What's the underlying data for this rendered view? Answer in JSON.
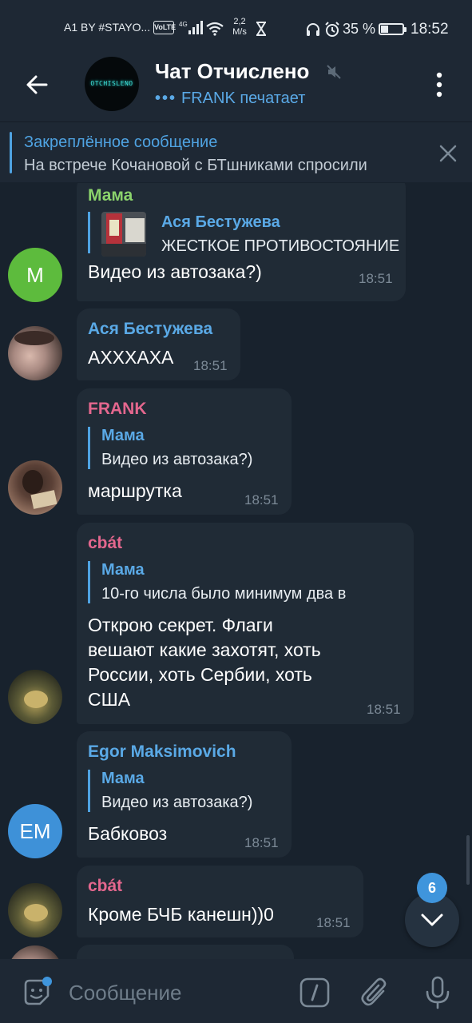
{
  "status_bar": {
    "carrier": "A1 BY #STAYO...",
    "volte": "VoLTE",
    "network": "4G",
    "speed_value": "2,2",
    "speed_unit": "M/s",
    "battery_text": "35 %",
    "battery_level": 0.35,
    "time": "18:52"
  },
  "header": {
    "title": "Чат Отчислено",
    "avatar_logo": "OTCHISLENO",
    "typing_dots": "•••",
    "typing_text": "FRANK печатает"
  },
  "pinned": {
    "title": "Закреплённое сообщение",
    "text": "На встрече Кочановой с БТшниками спросили"
  },
  "colors": {
    "accent": "#4fa3e2",
    "sender_mama": "#8bd36c",
    "sender_asya": "#5aa9e6",
    "sender_frank": "#e4678e",
    "sender_cbat": "#e4678e",
    "sender_egor": "#5aa9e6",
    "avatar_m": "#5dbb3d",
    "avatar_em": "#3e91d8"
  },
  "messages": [
    {
      "sender": "Мама",
      "reply_name": "Ася Бестужева",
      "reply_text": "ЖЕСТКОЕ ПРОТИВОСТОЯНИЕ",
      "text": "Видео из автозака?)",
      "time": "18:51",
      "avatar_letter": "М"
    },
    {
      "sender": "Ася Бестужева",
      "text": "АХХХАХА",
      "time": "18:51"
    },
    {
      "sender": "FRANK",
      "reply_name": "Мама",
      "reply_text": "Видео из автозака?)",
      "text": "маршрутка",
      "time": "18:51"
    },
    {
      "sender": "cbát",
      "reply_name": "Мама",
      "reply_text": "10-го числа было минимум два в",
      "text_lines": [
        "Открою секрет. Флаги",
        "вешают какие захотят, хоть",
        "России, хоть Сербии, хоть",
        "США"
      ],
      "time": "18:51"
    },
    {
      "sender": "Egor Maksimovich",
      "reply_name": "Мама",
      "reply_text": "Видео из автозака?)",
      "text": "Бабковоз",
      "time": "18:51",
      "avatar_letter": "EM"
    },
    {
      "sender": "cbát",
      "text": "Кроме БЧБ канешн))0",
      "time": "18:51"
    }
  ],
  "fab": {
    "unread": "6"
  },
  "input": {
    "placeholder": "Сообщение"
  },
  "icons": {
    "back": "arrow-left-icon",
    "mute": "muted-speaker-icon",
    "menu": "more-vertical-icon",
    "close": "close-icon",
    "scroll": "chevron-down-icon",
    "emoji": "sticker-icon",
    "command": "slash-command-icon",
    "attach": "paperclip-icon",
    "mic": "microphone-icon"
  }
}
